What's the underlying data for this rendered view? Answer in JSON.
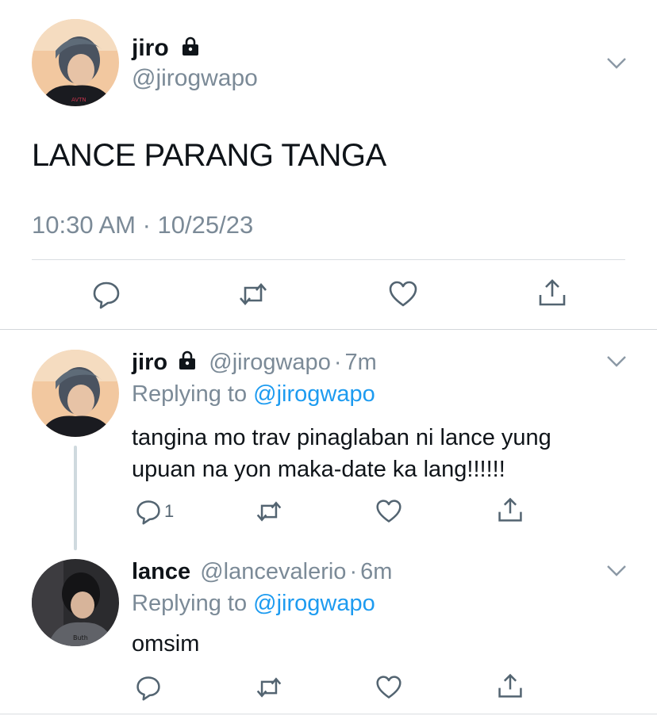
{
  "main_tweet": {
    "name": "jiro",
    "handle": "@jirogwapo",
    "text": "LANCE PARANG TANGA",
    "timestamp": "10:30 AM · 10/25/23",
    "locked": true
  },
  "replies": [
    {
      "name": "jiro",
      "handle": "@jirogwapo",
      "dot": "·",
      "time": "7m",
      "replying_prefix": "Replying to",
      "replying_handle": "@jirogwapo",
      "text_line1": "tangina mo trav pinaglaban ni lance yung",
      "text_line2": "upuan na yon maka-date ka lang!!!!!!",
      "reply_count": "1",
      "locked": true
    },
    {
      "name": "lance",
      "handle": "@lancevalerio",
      "dot": "·",
      "time": "6m",
      "replying_prefix": "Replying to",
      "replying_handle": "@jirogwapo",
      "text_line1": "omsim",
      "locked": false
    }
  ],
  "icons": {
    "reply": "reply-icon",
    "retweet": "retweet-icon",
    "like": "heart-icon",
    "share": "share-icon",
    "lock": "lock-icon",
    "more": "chevron-down-icon"
  },
  "colors": {
    "text": "#0f1419",
    "muted": "#7b8a97",
    "link": "#1d9bf0",
    "divider": "#d9dde1",
    "icon": "#536471"
  }
}
